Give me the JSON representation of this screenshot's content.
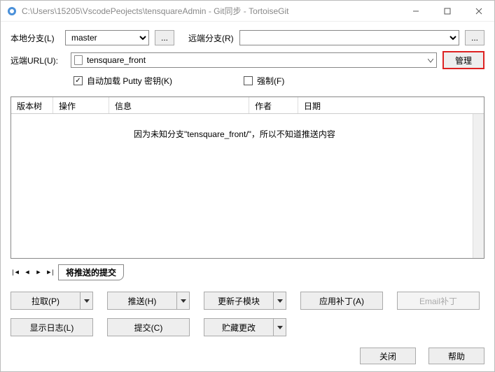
{
  "titlebar": {
    "title": "C:\\Users\\15205\\VscodePeojects\\tensquareAdmin - Git同步 - TortoiseGit"
  },
  "form": {
    "local_branch_label": "本地分支(L)",
    "local_branch_value": "master",
    "remote_branch_label": "远端分支(R)",
    "remote_url_label": "远端URL(U):",
    "remote_url_value": "tensquare_front",
    "manage_label": "管理",
    "autoload_putty_label": "自动加载 Putty 密钥(K)",
    "force_label": "强制(F)",
    "autoload_checked": true,
    "force_checked": false
  },
  "table": {
    "headers": {
      "tree": "版本树",
      "action": "操作",
      "info": "信息",
      "author": "作者",
      "date": "日期"
    },
    "message": "因为未知分支\"tensquare_front/\"，所以不知道推送内容"
  },
  "tabs": {
    "push_commits": "将推送的提交"
  },
  "buttons": {
    "pull": "拉取(P)",
    "push": "推送(H)",
    "update_submodule": "更新子模块",
    "apply_patch": "应用补丁(A)",
    "email_patch": "Email补丁",
    "show_log": "显示日志(L)",
    "commit": "提交(C)",
    "stash": "贮藏更改",
    "close": "关闭",
    "help": "帮助",
    "ellipsis": "..."
  }
}
